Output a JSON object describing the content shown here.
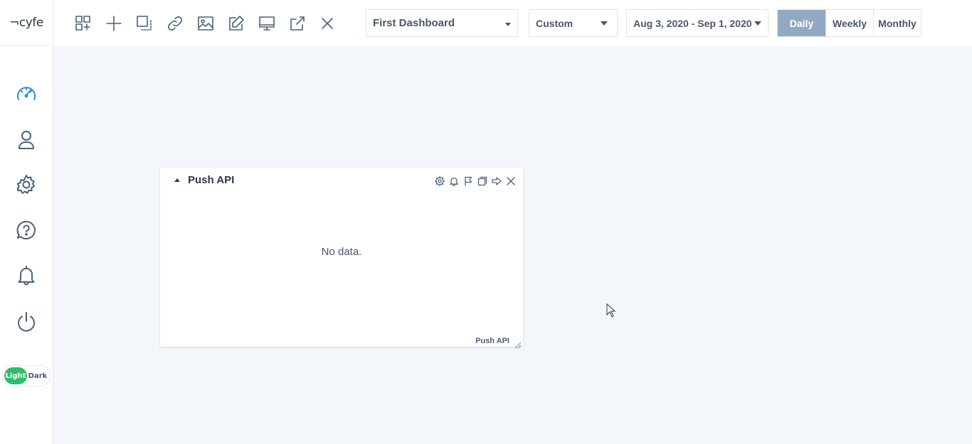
{
  "logo": {
    "text": "¬cyfe"
  },
  "sidebar": {
    "items": [
      {
        "icon": "dashboard-gauge-icon",
        "active": true
      },
      {
        "icon": "user-icon",
        "active": false
      },
      {
        "icon": "gear-icon",
        "active": false
      },
      {
        "icon": "help-chat-icon",
        "active": false
      },
      {
        "icon": "bell-icon",
        "active": false
      },
      {
        "icon": "power-icon",
        "active": false
      }
    ],
    "theme": {
      "light_label": "Light",
      "dark_label": "Dark",
      "selected": "Light"
    }
  },
  "toolbar": {
    "tools": [
      "add-widget-icon",
      "plus-icon",
      "resize-icon",
      "link-icon",
      "image-icon",
      "edit-icon",
      "monitor-icon",
      "share-icon",
      "close-icon"
    ],
    "dashboard_select": "First Dashboard",
    "range_select": "Custom",
    "date_range": "Aug 3, 2020 - Sep 1, 2020",
    "periods": [
      "Daily",
      "Weekly",
      "Monthly"
    ],
    "active_period": "Daily"
  },
  "widget": {
    "title": "Push API",
    "message": "No data.",
    "footer": "Push API",
    "tools": [
      "gear-icon",
      "bell-icon",
      "flag-icon",
      "copy-icon",
      "arrow-right-icon",
      "close-icon"
    ]
  },
  "colors": {
    "accent": "#2b8fd8",
    "active_period_bg": "#93a8c2",
    "theme_light_bg": "#2ebd6b",
    "page_bg": "#f3f6fb"
  }
}
